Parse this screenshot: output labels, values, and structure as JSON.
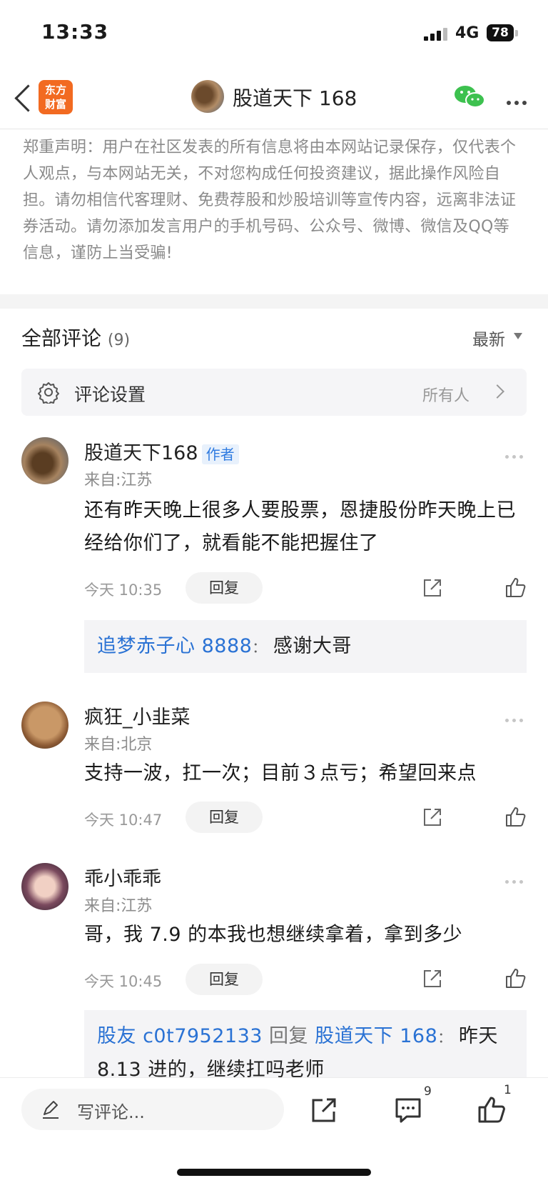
{
  "status_bar": {
    "time": "13:33",
    "network": "4G",
    "battery": "78"
  },
  "header": {
    "back_icon": "chevron-left-icon",
    "app_logo": "东方财富",
    "title": "股道天下 168",
    "wechat_icon": "wechat-icon",
    "more_icon": "more-horizontal-icon"
  },
  "disclaimer": "郑重声明：用户在社区发表的所有信息将由本网站记录保存，仅代表个人观点，与本网站无关，不对您构成任何投资建议，据此操作风险自担。请勿相信代客理财、免费荐股和炒股培训等宣传内容，远离非法证券活动。请勿添加发言用户的手机号码、公众号、微博、微信及QQ等信息，谨防上当受骗!",
  "comments_header": {
    "title": "全部评论",
    "count": "(9)",
    "sort": "最新"
  },
  "settings": {
    "label": "评论设置",
    "value": "所有人"
  },
  "comments": [
    {
      "name": "股道天下168",
      "badge": "作者",
      "location": "来自:江苏",
      "text": "还有昨天晚上很多人要股票，恩捷股份昨天晚上已经给你们了，就看能不能把握住了",
      "time": "今天 10:35",
      "reply_label": "回复",
      "replies": [
        {
          "user": "追梦赤子心 8888",
          "sep": "：",
          "text": "感谢大哥"
        }
      ]
    },
    {
      "name": "疯狂_小韭菜",
      "location": "来自:北京",
      "text": "支持一波，扛一次；目前３点亏；希望回来点",
      "time": "今天 10:47",
      "reply_label": "回复"
    },
    {
      "name": "乖小乖乖",
      "location": "来自:江苏",
      "text": "哥，我 7.9 的本我也想继续拿着，拿到多少",
      "time": "今天 10:45",
      "reply_label": "回复",
      "replies": [
        {
          "user": "股友 c0t7952133",
          "mid": " 回复 ",
          "target": "股道天下 168",
          "sep": "：",
          "text": "昨天",
          "text2": "8.13 进的，继续扛吗老师"
        }
      ]
    }
  ],
  "bottom_bar": {
    "write_placeholder": "写评论...",
    "comment_count": "9",
    "like_count": "1"
  },
  "colors": {
    "accent_blue": "#2a72d4",
    "brand_orange": "#f26a21",
    "wechat_green": "#3dc14f"
  }
}
